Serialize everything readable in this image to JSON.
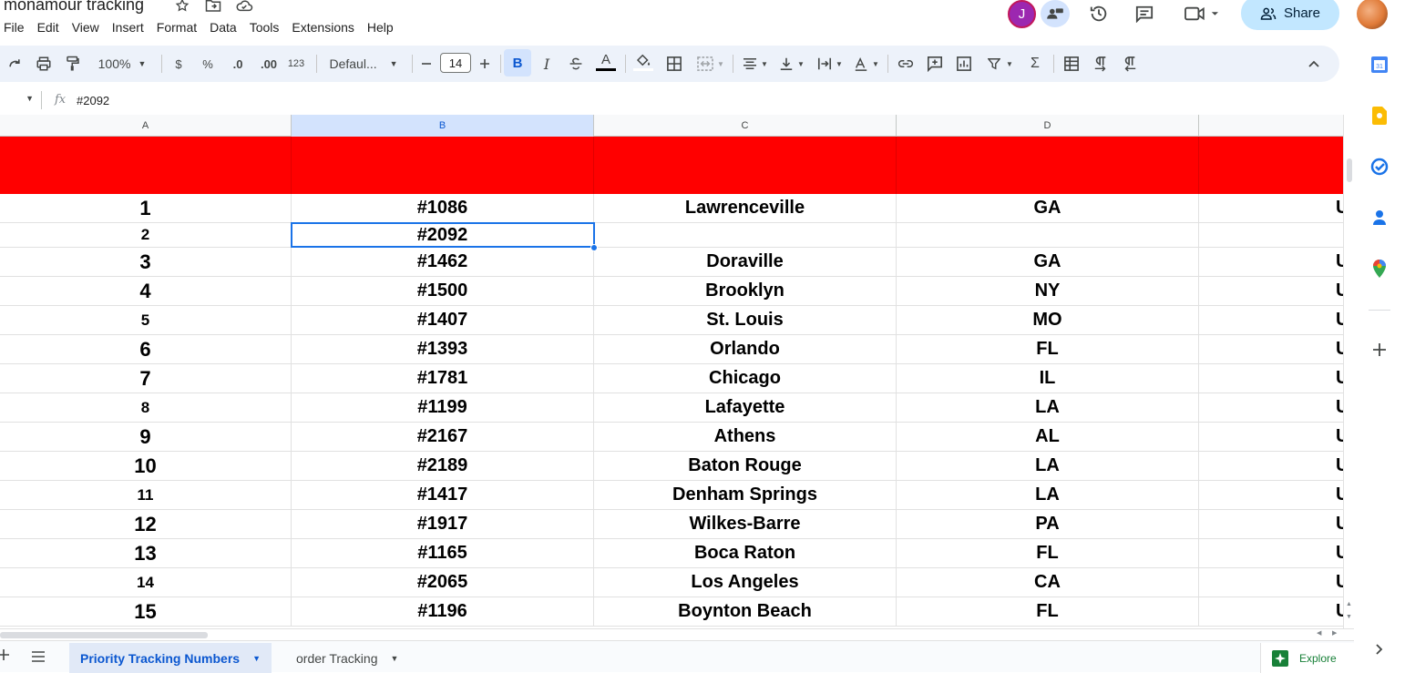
{
  "doc": {
    "title": "monamour tracking"
  },
  "menu": [
    "File",
    "Edit",
    "View",
    "Insert",
    "Format",
    "Data",
    "Tools",
    "Extensions",
    "Help"
  ],
  "header": {
    "avatar_letter": "J",
    "share_label": "Share"
  },
  "toolbar": {
    "zoom": "100%",
    "currency": "$",
    "percent": "%",
    "dec_decrease": ".0",
    "dec_increase": ".00",
    "number_format": "123",
    "font_name": "Defaul...",
    "font_size": "14",
    "bold": "B",
    "italic": "I",
    "text_color_letter": "A"
  },
  "formula_bar": {
    "fx": "fx",
    "value": "#2092"
  },
  "columns": [
    "A",
    "B",
    "C",
    "D"
  ],
  "selected_column": "B",
  "rows": [
    {
      "a": "1",
      "b": "#1086",
      "c": "Lawrenceville",
      "d": "GA",
      "e": "U",
      "size": "big"
    },
    {
      "a": "2",
      "b": "#2092",
      "c": "",
      "d": "",
      "e": "",
      "size": "small"
    },
    {
      "a": "3",
      "b": "#1462",
      "c": "Doraville",
      "d": "GA",
      "e": "U",
      "size": "big"
    },
    {
      "a": "4",
      "b": "#1500",
      "c": "Brooklyn",
      "d": "NY",
      "e": "U",
      "size": "big"
    },
    {
      "a": "5",
      "b": "#1407",
      "c": "St. Louis",
      "d": "MO",
      "e": "U",
      "size": "small"
    },
    {
      "a": "6",
      "b": "#1393",
      "c": "Orlando",
      "d": "FL",
      "e": "U",
      "size": "big"
    },
    {
      "a": "7",
      "b": "#1781",
      "c": "Chicago",
      "d": "IL",
      "e": "U",
      "size": "big"
    },
    {
      "a": "8",
      "b": "#1199",
      "c": "Lafayette",
      "d": "LA",
      "e": "U",
      "size": "small"
    },
    {
      "a": "9",
      "b": "#2167",
      "c": "Athens",
      "d": "AL",
      "e": "U",
      "size": "big"
    },
    {
      "a": "10",
      "b": "#2189",
      "c": "Baton Rouge",
      "d": "LA",
      "e": "U",
      "size": "big"
    },
    {
      "a": "11",
      "b": "#1417",
      "c": "Denham Springs",
      "d": "LA",
      "e": "U",
      "size": "small"
    },
    {
      "a": "12",
      "b": "#1917",
      "c": "Wilkes-Barre",
      "d": "PA",
      "e": "U",
      "size": "big"
    },
    {
      "a": "13",
      "b": "#1165",
      "c": "Boca Raton",
      "d": "FL",
      "e": "U",
      "size": "big"
    },
    {
      "a": "14",
      "b": "#2065",
      "c": "Los Angeles",
      "d": "CA",
      "e": "U",
      "size": "small"
    },
    {
      "a": "15",
      "b": "#1196",
      "c": "Boynton Beach",
      "d": "FL",
      "e": "U",
      "size": "big"
    }
  ],
  "sheets": [
    {
      "label": "Priority Tracking Numbers",
      "active": true
    },
    {
      "label": "order Tracking",
      "active": false
    }
  ],
  "explore_label": "Explore",
  "colors": {
    "header_band": "#ff0000",
    "selection": "#1a73e8",
    "share_bg": "#c2e7ff",
    "toolbar_bg": "#edf2fa"
  }
}
